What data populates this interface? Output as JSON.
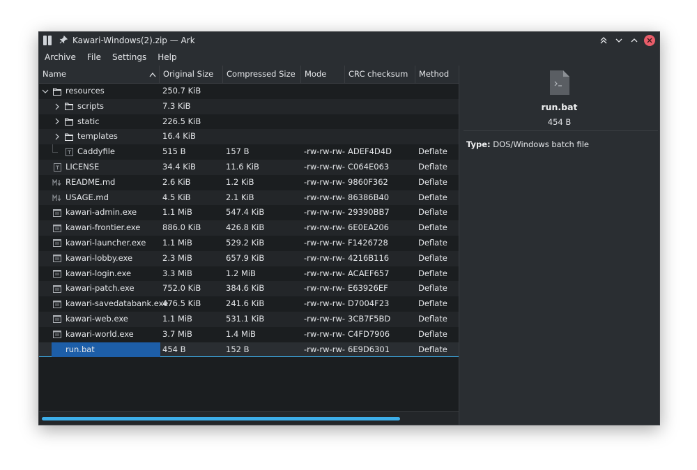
{
  "window": {
    "title": "Kawari-Windows(2).zip — Ark"
  },
  "menu": [
    "Archive",
    "File",
    "Settings",
    "Help"
  ],
  "columns": [
    "Name",
    "Original Size",
    "Compressed Size",
    "Mode",
    "CRC checksum",
    "Method"
  ],
  "rows": [
    {
      "name": "resources",
      "depth": 0,
      "type": "folder",
      "expander": "open",
      "orig": "250.7 KiB",
      "comp": "",
      "mode": "",
      "crc": "",
      "method": ""
    },
    {
      "name": "scripts",
      "depth": 1,
      "type": "folder",
      "expander": "closed",
      "orig": "7.3 KiB",
      "comp": "",
      "mode": "",
      "crc": "",
      "method": ""
    },
    {
      "name": "static",
      "depth": 1,
      "type": "folder",
      "expander": "closed",
      "orig": "226.5 KiB",
      "comp": "",
      "mode": "",
      "crc": "",
      "method": ""
    },
    {
      "name": "templates",
      "depth": 1,
      "type": "folder",
      "expander": "closed",
      "orig": "16.4 KiB",
      "comp": "",
      "mode": "",
      "crc": "",
      "method": ""
    },
    {
      "name": "Caddyfile",
      "depth": 1,
      "type": "text",
      "expander": "none",
      "orig": "515 B",
      "comp": "157 B",
      "mode": "-rw-rw-rw-",
      "crc": "ADEF4D4D",
      "method": "Deflate"
    },
    {
      "name": "LICENSE",
      "depth": 0,
      "type": "text",
      "expander": "none",
      "orig": "34.4 KiB",
      "comp": "11.6 KiB",
      "mode": "-rw-rw-rw-",
      "crc": "C064E063",
      "method": "Deflate"
    },
    {
      "name": "README.md",
      "depth": 0,
      "type": "markdown",
      "expander": "none",
      "orig": "2.6 KiB",
      "comp": "1.2 KiB",
      "mode": "-rw-rw-rw-",
      "crc": "9860F362",
      "method": "Deflate"
    },
    {
      "name": "USAGE.md",
      "depth": 0,
      "type": "markdown",
      "expander": "none",
      "orig": "4.5 KiB",
      "comp": "2.1 KiB",
      "mode": "-rw-rw-rw-",
      "crc": "86386B40",
      "method": "Deflate"
    },
    {
      "name": "kawari-admin.exe",
      "depth": 0,
      "type": "exe",
      "expander": "none",
      "orig": "1.1 MiB",
      "comp": "547.4 KiB",
      "mode": "-rw-rw-rw-",
      "crc": "29390BB7",
      "method": "Deflate"
    },
    {
      "name": "kawari-frontier.exe",
      "depth": 0,
      "type": "exe",
      "expander": "none",
      "orig": "886.0 KiB",
      "comp": "426.8 KiB",
      "mode": "-rw-rw-rw-",
      "crc": "6E0EA206",
      "method": "Deflate"
    },
    {
      "name": "kawari-launcher.exe",
      "depth": 0,
      "type": "exe",
      "expander": "none",
      "orig": "1.1 MiB",
      "comp": "529.2 KiB",
      "mode": "-rw-rw-rw-",
      "crc": "F1426728",
      "method": "Deflate"
    },
    {
      "name": "kawari-lobby.exe",
      "depth": 0,
      "type": "exe",
      "expander": "none",
      "orig": "2.3 MiB",
      "comp": "657.9 KiB",
      "mode": "-rw-rw-rw-",
      "crc": "4216B116",
      "method": "Deflate"
    },
    {
      "name": "kawari-login.exe",
      "depth": 0,
      "type": "exe",
      "expander": "none",
      "orig": "3.3 MiB",
      "comp": "1.2 MiB",
      "mode": "-rw-rw-rw-",
      "crc": "ACAEF657",
      "method": "Deflate"
    },
    {
      "name": "kawari-patch.exe",
      "depth": 0,
      "type": "exe",
      "expander": "none",
      "orig": "752.0 KiB",
      "comp": "384.6 KiB",
      "mode": "-rw-rw-rw-",
      "crc": "E63926EF",
      "method": "Deflate"
    },
    {
      "name": "kawari-savedatabank.exe",
      "depth": 0,
      "type": "exe",
      "expander": "none",
      "orig": "476.5 KiB",
      "comp": "241.6 KiB",
      "mode": "-rw-rw-rw-",
      "crc": "D7004F23",
      "method": "Deflate"
    },
    {
      "name": "kawari-web.exe",
      "depth": 0,
      "type": "exe",
      "expander": "none",
      "orig": "1.1 MiB",
      "comp": "531.1 KiB",
      "mode": "-rw-rw-rw-",
      "crc": "3CB7F5BD",
      "method": "Deflate"
    },
    {
      "name": "kawari-world.exe",
      "depth": 0,
      "type": "exe",
      "expander": "none",
      "orig": "3.7 MiB",
      "comp": "1.4 MiB",
      "mode": "-rw-rw-rw-",
      "crc": "C4FD7906",
      "method": "Deflate"
    },
    {
      "name": "run.bat",
      "depth": 0,
      "type": "script",
      "expander": "none",
      "orig": "454 B",
      "comp": "152 B",
      "mode": "-rw-rw-rw-",
      "crc": "6E9D6301",
      "method": "Deflate",
      "selected": true
    }
  ],
  "details": {
    "name": "run.bat",
    "size": "454 B",
    "type_label": "Type:",
    "type_value": "DOS/Windows batch file"
  },
  "colors": {
    "accent": "#3daee9",
    "selection": "#1d5ea8",
    "close": "#e95d6a"
  }
}
